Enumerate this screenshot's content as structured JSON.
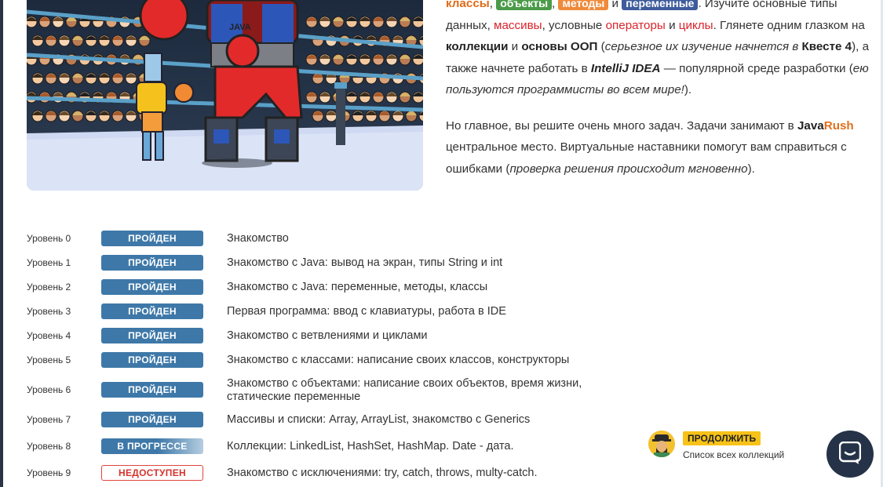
{
  "description": {
    "p1": {
      "tag_classes": "классы",
      "sep1": ", ",
      "tag_objects": "объекты",
      "sep2": ", ",
      "tag_methods": "методы",
      "and1": " и ",
      "tag_variables": "переменные",
      "t1": ". Изучите основные типы данных, ",
      "arrays": "массивы",
      "t2": ", условные ",
      "operators": "операторы",
      "and2": " и ",
      "loops": "циклы",
      "t3": ". Глянете одним глазком на ",
      "collections": "коллекции",
      "and3": " и ",
      "oop": "основы ООП",
      "t4": " (",
      "italic1": "серьезное их изучение начнется в ",
      "quest": "Квесте 4",
      "t5": "), а также начнете работать в ",
      "idea": "IntelliJ IDEA",
      "t6": " — популярной среде разработки (",
      "italic2": "ею пользуются программисты во всем мире!",
      "t7": ")."
    },
    "p2": {
      "t1": "Но главное, вы решите очень много задач. Задачи занимают в ",
      "java": "Java",
      "rush": "Rush",
      "t2": " центральное место. Виртуальные наставники помогут вам справиться с ошибками (",
      "italic": "проверка решения происходит мгновенно",
      "t3": ")."
    }
  },
  "levels": [
    {
      "label": "Уровень 0",
      "status": "ПРОЙДЕН",
      "title": "Знакомство"
    },
    {
      "label": "Уровень 1",
      "status": "ПРОЙДЕН",
      "title": "Знакомство с Java: вывод на экран, типы String и int"
    },
    {
      "label": "Уровень 2",
      "status": "ПРОЙДЕН",
      "title": "Знакомство с Java: переменные, методы, классы"
    },
    {
      "label": "Уровень 3",
      "status": "ПРОЙДЕН",
      "title": "Первая программа: ввод с клавиатуры, работа в IDE"
    },
    {
      "label": "Уровень 4",
      "status": "ПРОЙДЕН",
      "title": "Знакомство с ветвлениями и циклами"
    },
    {
      "label": "Уровень 5",
      "status": "ПРОЙДЕН",
      "title": "Знакомство с классами: написание своих классов, конструкторы"
    },
    {
      "label": "Уровень 6",
      "status": "ПРОЙДЕН",
      "title": "Знакомство с объектами: написание своих объектов, время жизни, статические переменные"
    },
    {
      "label": "Уровень 7",
      "status": "ПРОЙДЕН",
      "title": "Массивы и списки: Array, ArrayList, знакомство с Generics"
    },
    {
      "label": "Уровень 8",
      "status": "В ПРОГРЕССЕ",
      "title": "Коллекции: LinkedList, HashSet, HashMap. Date - дата."
    },
    {
      "label": "Уровень 9",
      "status": "НЕДОСТУПЕН",
      "title": "Знакомство с исключениями: try, catch, throws, multy-catch."
    }
  ],
  "continue": {
    "button": "ПРОДОЛЖИТЬ",
    "subtitle": "Список всех коллекций"
  },
  "hero": {
    "robot_label": "JAVA"
  },
  "icons": {
    "chat": "chat-bubble-icon",
    "avatar": "mentor-avatar-icon"
  },
  "colors": {
    "done": "#3e78a8",
    "locked": "#e0443e",
    "continue": "#f7c219",
    "chat_bg": "#263247"
  }
}
